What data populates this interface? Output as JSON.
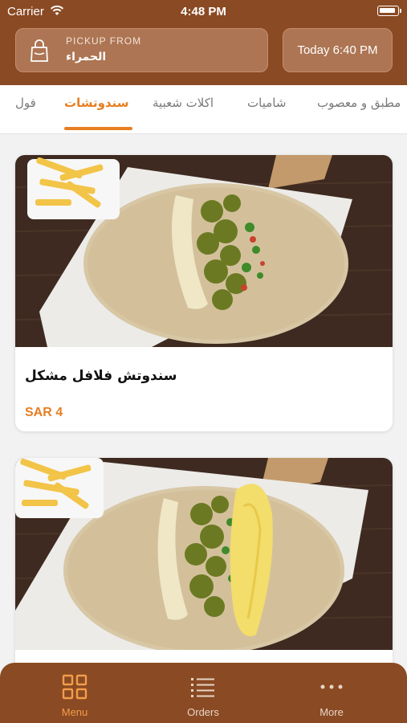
{
  "status_bar": {
    "carrier": "Carrier",
    "time": "4:48 PM"
  },
  "header": {
    "pickup_label": "PICKUP FROM",
    "pickup_location": "الحمراء",
    "pickup_time": "Today 6:40 PM",
    "icon": "shopping-bag-icon"
  },
  "tabs": [
    {
      "label": "فول",
      "active": false
    },
    {
      "label": "سندوتشات",
      "active": true
    },
    {
      "label": "اكلات شعبية",
      "active": false
    },
    {
      "label": "شاميات",
      "active": false
    },
    {
      "label": "مطبق و معصوب",
      "active": false
    }
  ],
  "products": [
    {
      "name": "سندوتش فلافل مشكل",
      "price": "SAR 4",
      "image": "falafel-wrap-photo"
    },
    {
      "name": "",
      "price": "",
      "image": "falafel-egg-wrap-photo"
    }
  ],
  "bottom_nav": [
    {
      "label": "Menu",
      "icon": "grid-icon",
      "active": true
    },
    {
      "label": "Orders",
      "icon": "list-icon",
      "active": false
    },
    {
      "label": "More",
      "icon": "more-dots-icon",
      "active": false
    }
  ],
  "colors": {
    "brand": "#8a4a23",
    "accent": "#e67e22",
    "button": "#ad7553"
  }
}
